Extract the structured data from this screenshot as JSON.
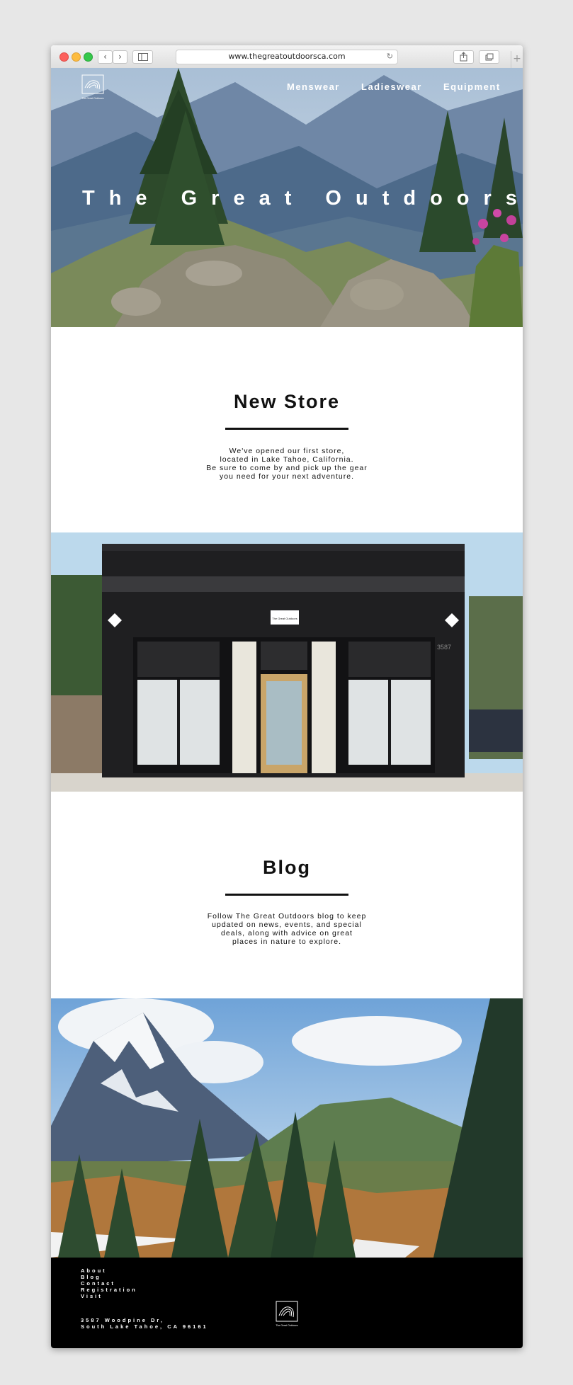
{
  "browser": {
    "url": "www.thegreatoutdoorsca.com"
  },
  "site": {
    "logo_text": "The Great Outdoors",
    "nav": [
      "Menswear",
      "Ladieswear",
      "Equipment"
    ],
    "hero_title": "The Great Outdoors"
  },
  "new_store": {
    "heading": "New Store",
    "lines": [
      "We've opened our first store,",
      "located in Lake Tahoe, California.",
      "Be sure to come by and pick up the gear",
      "you need for your next adventure."
    ],
    "sign_text": "The Great Outdoors",
    "address_number": "3587"
  },
  "blog": {
    "heading": "Blog",
    "lines": [
      "Follow The Great Outdoors blog to keep",
      "updated on news, events, and special",
      "deals, along with advice on great",
      "places in nature to explore."
    ]
  },
  "footer": {
    "links": [
      "About",
      "Blog",
      "Contact",
      "Registration",
      "Visit"
    ],
    "address_lines": [
      "3587 Woodpine Dr,",
      "South Lake Tahoe, CA 96161"
    ],
    "logo_text": "The Great Outdoors"
  },
  "colors": {
    "footer_bg": "#000000",
    "accent_text": "#111111",
    "page_bg": "#e7e7e7"
  }
}
